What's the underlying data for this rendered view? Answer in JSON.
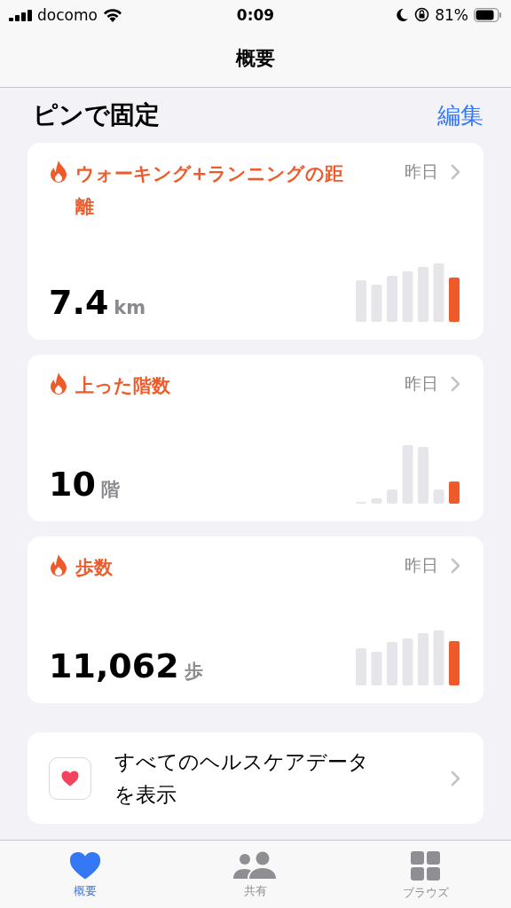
{
  "status_bar": {
    "carrier": "docomo",
    "time": "0:09",
    "battery": "81%"
  },
  "nav": {
    "title": "概要"
  },
  "section": {
    "title": "ピンで固定",
    "action": "編集"
  },
  "cards": [
    {
      "title": "ウォーキング+ランニングの距離",
      "date": "昨日",
      "value": "7.4",
      "unit": "km"
    },
    {
      "title": "上った階数",
      "date": "昨日",
      "value": "10",
      "unit": "階"
    },
    {
      "title": "歩数",
      "date": "昨日",
      "value": "11,062",
      "unit": "歩"
    }
  ],
  "all_data": {
    "label": "すべてのヘルスケアデータを表示"
  },
  "tabs": [
    {
      "label": "概要",
      "selected": true
    },
    {
      "label": "共有",
      "selected": false
    },
    {
      "label": "ブラウズ",
      "selected": false
    }
  ]
}
